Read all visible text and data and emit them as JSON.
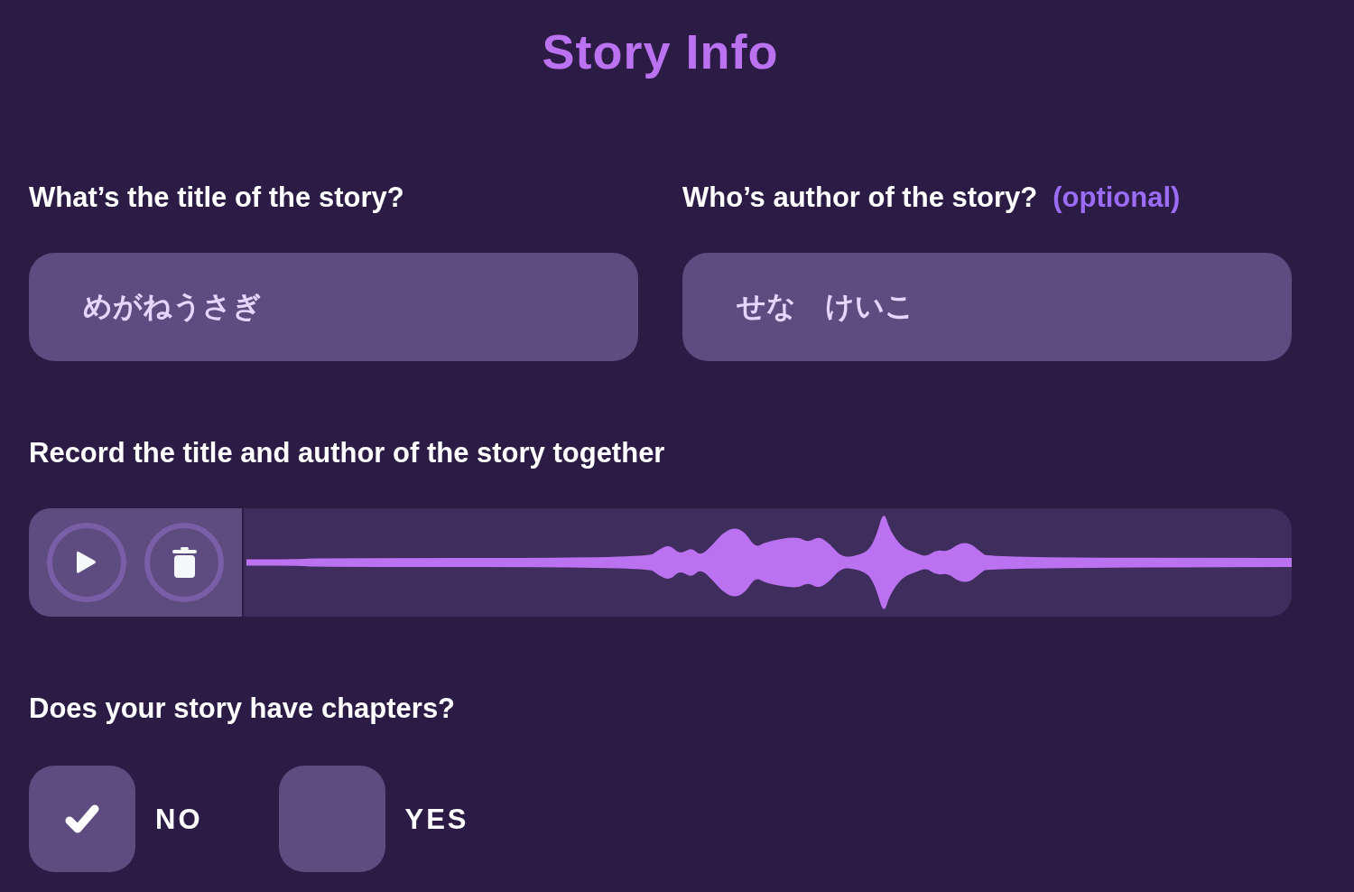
{
  "title": "Story Info",
  "fields": [
    {
      "label": "What’s the title of the story?",
      "value": "めがねうさぎ"
    },
    {
      "label": "Who’s author of the story?",
      "hint": "(optional)",
      "value": "せな　けいこ"
    }
  ],
  "recording": {
    "label": "Record the title and author of the story together",
    "buttons": [
      {
        "kind": "play"
      },
      {
        "kind": "delete"
      }
    ]
  },
  "chapters": {
    "question": "Does your story have chapters?",
    "options": [
      {
        "label": "NO",
        "checked": true
      },
      {
        "label": "YES",
        "checked": false
      }
    ]
  }
}
